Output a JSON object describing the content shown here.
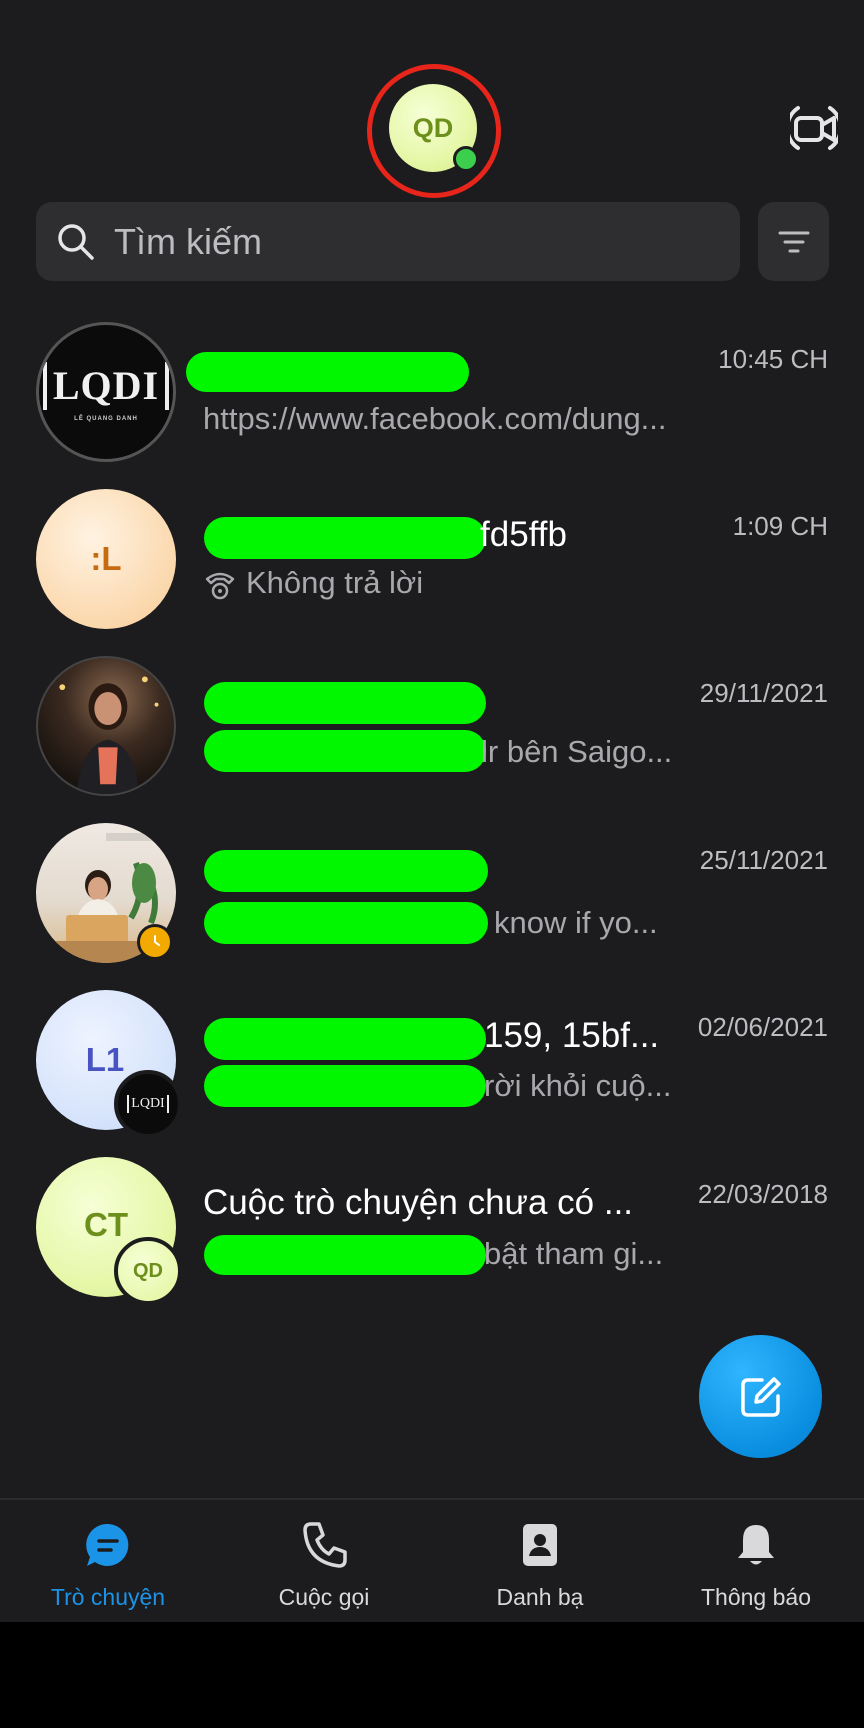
{
  "header": {
    "profile_initials": "QD",
    "video_icon": "video-call-icon"
  },
  "search": {
    "placeholder": "Tìm kiếm",
    "icon": "search-icon",
    "filter_icon": "filter-icon"
  },
  "conversations": [
    {
      "title": "",
      "subtitle": "https://www.facebook.com/dung...",
      "time": "10:45 CH",
      "avatar_text": "LQDI",
      "avatar_subtext": "LÊ QUANG DANH"
    },
    {
      "title": "fd5ffb",
      "subtitle": "Không trả lời",
      "subtitle_icon": "missed-call-icon",
      "time": "1:09 CH",
      "avatar_text": ":L"
    },
    {
      "title": "",
      "subtitle": "lr bên Saigo...",
      "time": "29/11/2021",
      "avatar_text": ""
    },
    {
      "title": "",
      "subtitle": "know if yo...",
      "time": "25/11/2021",
      "avatar_text": ""
    },
    {
      "title": "159, 15bf...",
      "subtitle": "rời khỏi cuộ...",
      "time": "02/06/2021",
      "avatar_text": "L1",
      "badge_text": "LQDI"
    },
    {
      "title": "Cuộc trò chuyện chưa có ...",
      "subtitle": "bật tham gi...",
      "time": "22/03/2018",
      "avatar_text": "CT",
      "badge_text": "QD"
    }
  ],
  "fab": {
    "icon": "compose-icon"
  },
  "nav": {
    "items": [
      {
        "label": "Trò chuyện",
        "icon": "chat-icon",
        "active": true
      },
      {
        "label": "Cuộc gọi",
        "icon": "phone-icon",
        "active": false
      },
      {
        "label": "Danh bạ",
        "icon": "contacts-icon",
        "active": false
      },
      {
        "label": "Thông báo",
        "icon": "bell-icon",
        "active": false
      }
    ]
  },
  "colors": {
    "background": "#1c1c1e",
    "accent": "#1b93e6",
    "redaction": "#00f700",
    "online": "#3ccf4e",
    "highlight_ring": "#e8251a"
  }
}
